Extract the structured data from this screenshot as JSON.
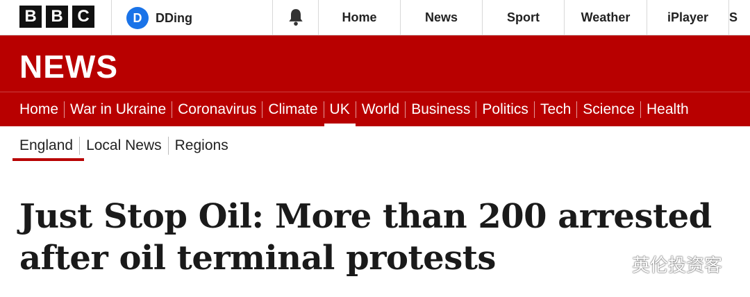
{
  "brand": {
    "logo_letters": [
      "B",
      "B",
      "C"
    ]
  },
  "account": {
    "initial": "D",
    "name": "DDing",
    "avatar_color": "#1a73e8"
  },
  "topnav": {
    "notifications_icon": "bell-icon",
    "items": [
      "Home",
      "News",
      "Sport",
      "Weather",
      "iPlayer",
      "S"
    ]
  },
  "news_band": {
    "wordmark": "NEWS",
    "color": "#b80000"
  },
  "sections": {
    "items": [
      "Home",
      "War in Ukraine",
      "Coronavirus",
      "Climate",
      "UK",
      "World",
      "Business",
      "Politics",
      "Tech",
      "Science",
      "Health"
    ],
    "active": "UK"
  },
  "subnav": {
    "items": [
      "England",
      "Local News",
      "Regions"
    ],
    "active": "England"
  },
  "article": {
    "headline_line1": "Just Stop Oil: More than 200 arrested",
    "headline_line2": "after oil terminal protests"
  },
  "watermark": {
    "text": "英伦投资客",
    "icon": "wechat-icon"
  }
}
